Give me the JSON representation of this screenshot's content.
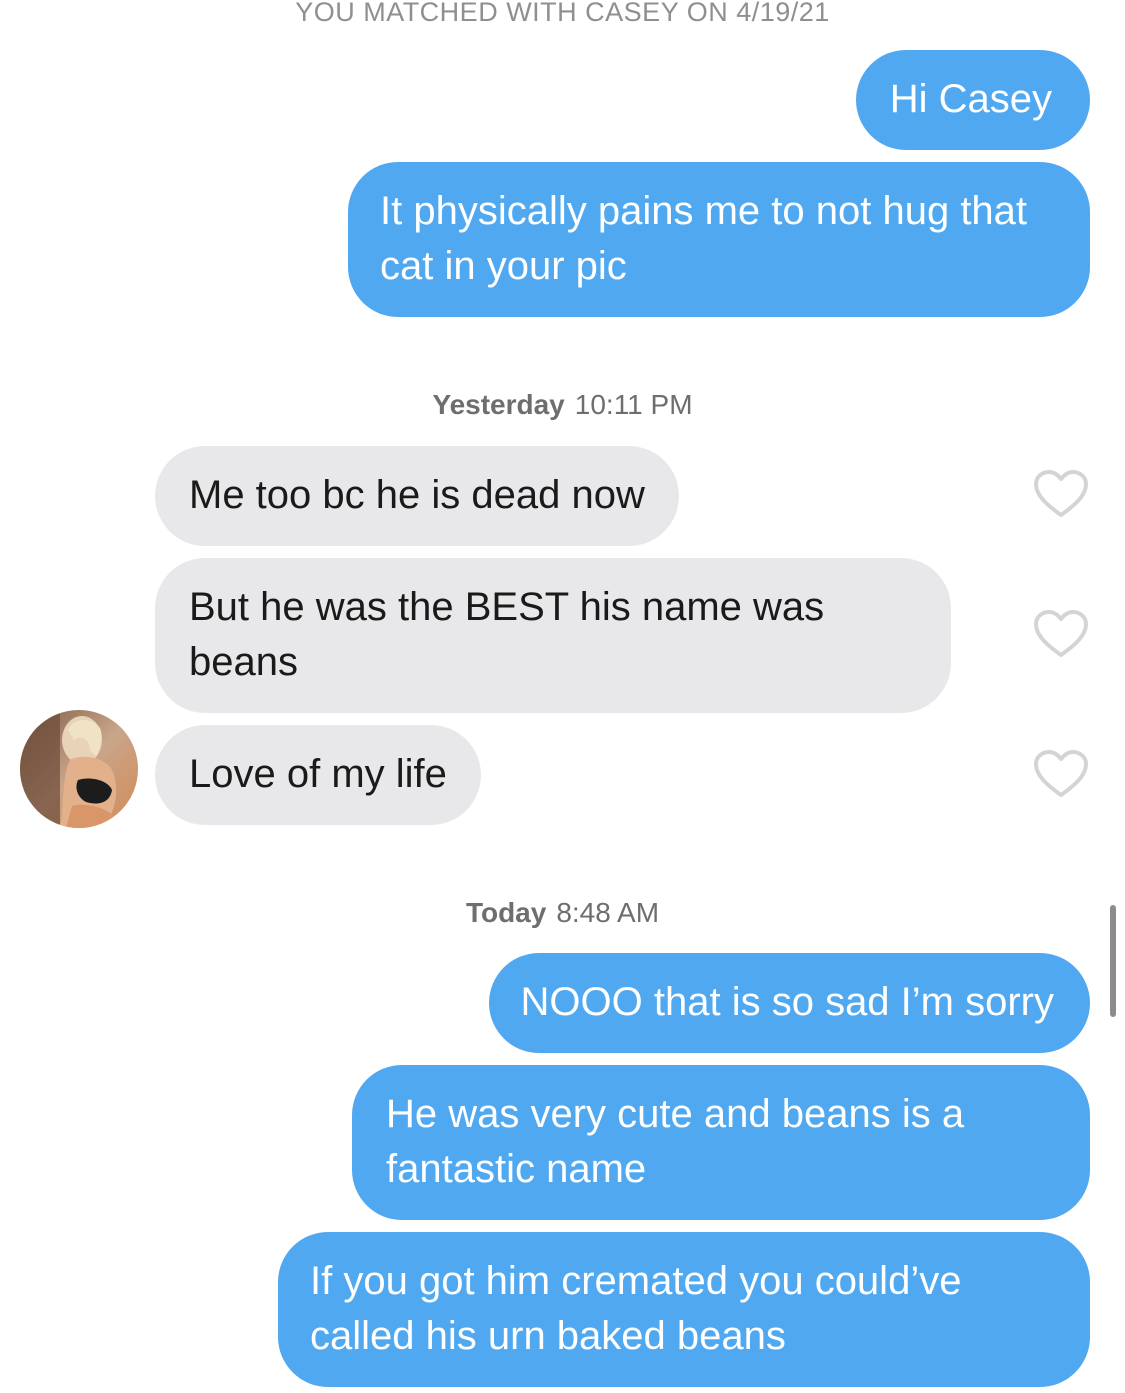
{
  "match_banner": "YOU MATCHED WITH CASEY ON 4/19/21",
  "conversation": {
    "opening_messages": [
      {
        "text": "Hi Casey",
        "direction": "outgoing"
      },
      {
        "text": "It physically pains me to not hug that cat in your pic",
        "direction": "outgoing"
      }
    ],
    "yesterday": {
      "day": "Yesterday",
      "time": "10:11 PM",
      "messages": [
        {
          "text": "Me too bc he is dead now",
          "direction": "incoming"
        },
        {
          "text": "But he was the BEST his name was beans",
          "direction": "incoming"
        },
        {
          "text": "Love of my life",
          "direction": "incoming"
        }
      ]
    },
    "today": {
      "day": "Today",
      "time": "8:48 AM",
      "messages": [
        {
          "text": "NOOO that is so sad I’m sorry",
          "direction": "outgoing"
        },
        {
          "text": "He was very cute and beans is a fantastic name",
          "direction": "outgoing"
        },
        {
          "text": "If you got him cremated you could’ve called his urn baked beans",
          "direction": "outgoing"
        }
      ]
    }
  },
  "icons": {
    "like": "heart-outline-icon",
    "avatar": "match-avatar"
  },
  "colors": {
    "outgoing_bubble": "#4fa8f0",
    "incoming_bubble": "#e8e8ea",
    "incoming_text": "#1a1a1a",
    "timestamp": "#6e6e6e",
    "banner": "#8f8f8f",
    "heart_outline": "#d4d4d4"
  }
}
